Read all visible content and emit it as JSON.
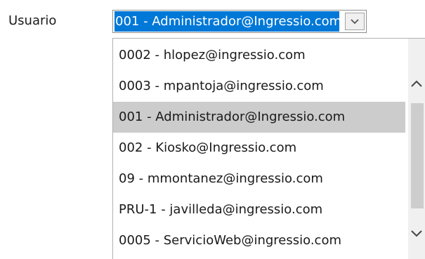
{
  "form": {
    "user_label": "Usuario"
  },
  "combo": {
    "selected_value": "001 - Administrador@Ingressio.com",
    "arrow_icon": "chevron-down-icon"
  },
  "dropdown": {
    "items": [
      {
        "label": "0002 - hlopez@ingressio.com"
      },
      {
        "label": "0003 - mpantoja@ingressio.com"
      },
      {
        "label": "001 - Administrador@Ingressio.com"
      },
      {
        "label": "002 - Kiosko@Ingressio.com"
      },
      {
        "label": "09 - mmontanez@ingressio.com"
      },
      {
        "label": "PRU-1 - javilleda@ingressio.com"
      },
      {
        "label": "0005 - ServicioWeb@ingressio.com"
      }
    ],
    "selected_index": 2
  },
  "scrollbar": {
    "up_icon": "chevron-up-icon",
    "down_icon": "chevron-down-icon"
  },
  "colors": {
    "selection_blue": "#0078d7",
    "hover_gray": "#cccccc",
    "scrollbar_track": "#f0f0f0"
  }
}
